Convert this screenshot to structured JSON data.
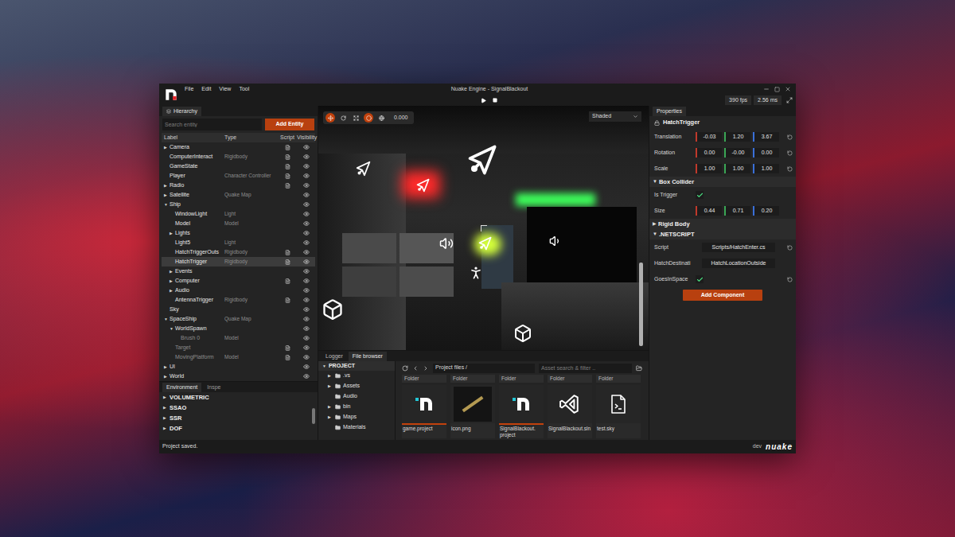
{
  "window": {
    "title": "Nuake Engine - SignalBlackout",
    "menu": [
      "File",
      "Edit",
      "View",
      "Tool"
    ],
    "fps": "390 fps",
    "frame_time": "2.56 ms"
  },
  "glyphs": {
    "expanded": "▼",
    "collapsed": "▶"
  },
  "hierarchy": {
    "tab": "Hierarchy",
    "search_placeholder": "Search entity",
    "add_button": "Add Entity",
    "columns": [
      "Label",
      "Type",
      "Script",
      "Visibility"
    ],
    "rows": [
      {
        "label": "Camera",
        "type": "",
        "script": true,
        "visible": true,
        "expandable": true,
        "expanded": false,
        "selected": false,
        "disabled": false
      },
      {
        "label": "ComputerInteract",
        "type": "Rigidbody",
        "script": true,
        "visible": true,
        "expandable": false,
        "expanded": false,
        "selected": false,
        "disabled": false
      },
      {
        "label": "GameState",
        "type": "",
        "script": true,
        "visible": true,
        "expandable": false,
        "expanded": false,
        "selected": false,
        "disabled": false
      },
      {
        "label": "Player",
        "type": "Character Controller",
        "script": true,
        "visible": true,
        "expandable": false,
        "expanded": false,
        "selected": false,
        "disabled": false
      },
      {
        "label": "Radio",
        "type": "",
        "script": true,
        "visible": true,
        "expandable": true,
        "expanded": false,
        "selected": false,
        "disabled": false
      },
      {
        "label": "Satellite",
        "type": "Quake Map",
        "script": false,
        "visible": true,
        "expandable": true,
        "expanded": false,
        "selected": false,
        "disabled": false
      },
      {
        "label": "Ship",
        "type": "",
        "script": false,
        "visible": true,
        "expandable": true,
        "expanded": true,
        "selected": false,
        "disabled": false,
        "children": [
          {
            "label": "WindowLight",
            "type": "Light",
            "script": false,
            "visible": true,
            "expandable": false,
            "expanded": false,
            "selected": false,
            "disabled": false
          },
          {
            "label": "Model",
            "type": "Model",
            "script": false,
            "visible": true,
            "expandable": false,
            "expanded": false,
            "selected": false,
            "disabled": false
          },
          {
            "label": "Lights",
            "type": "",
            "script": false,
            "visible": true,
            "expandable": true,
            "expanded": false,
            "selected": false,
            "disabled": false
          },
          {
            "label": "Light5",
            "type": "Light",
            "script": false,
            "visible": true,
            "expandable": false,
            "expanded": false,
            "selected": false,
            "disabled": false
          },
          {
            "label": "HatchTriggerOuts",
            "type": "Rigidbody",
            "script": true,
            "visible": true,
            "expandable": false,
            "expanded": false,
            "selected": false,
            "disabled": false
          },
          {
            "label": "HatchTrigger",
            "type": "Rigidbody",
            "script": true,
            "visible": true,
            "expandable": false,
            "expanded": false,
            "selected": true,
            "disabled": false
          },
          {
            "label": "Events",
            "type": "",
            "script": false,
            "visible": true,
            "expandable": true,
            "expanded": false,
            "selected": false,
            "disabled": false
          },
          {
            "label": "Computer",
            "type": "",
            "script": true,
            "visible": true,
            "expandable": true,
            "expanded": false,
            "selected": false,
            "disabled": false
          },
          {
            "label": "Audio",
            "type": "",
            "script": false,
            "visible": true,
            "expandable": true,
            "expanded": false,
            "selected": false,
            "disabled": false
          },
          {
            "label": "AntennaTrigger",
            "type": "Rigidbody",
            "script": true,
            "visible": true,
            "expandable": false,
            "expanded": false,
            "selected": false,
            "disabled": false
          }
        ]
      },
      {
        "label": "Sky",
        "type": "",
        "script": false,
        "visible": true,
        "expandable": false,
        "expanded": false,
        "selected": false,
        "disabled": false
      },
      {
        "label": "SpaceShip",
        "type": "Quake Map",
        "script": false,
        "visible": true,
        "expandable": true,
        "expanded": true,
        "selected": false,
        "disabled": false,
        "children": [
          {
            "label": "WorldSpawn",
            "type": "",
            "script": false,
            "visible": true,
            "expandable": true,
            "expanded": true,
            "selected": false,
            "disabled": false,
            "children": [
              {
                "label": "Brush 0",
                "type": "Model",
                "script": false,
                "visible": true,
                "expandable": false,
                "expanded": false,
                "selected": false,
                "disabled": true
              }
            ]
          },
          {
            "label": "Target",
            "type": "",
            "script": true,
            "visible": true,
            "expandable": false,
            "expanded": false,
            "selected": false,
            "disabled": true
          },
          {
            "label": "MovingPlatform",
            "type": "Model",
            "script": true,
            "visible": true,
            "expandable": false,
            "expanded": false,
            "selected": false,
            "disabled": true
          }
        ]
      },
      {
        "label": "UI",
        "type": "",
        "script": false,
        "visible": true,
        "expandable": true,
        "expanded": false,
        "selected": false,
        "disabled": false
      },
      {
        "label": "World",
        "type": "",
        "script": false,
        "visible": true,
        "expandable": true,
        "expanded": false,
        "selected": false,
        "disabled": false
      }
    ]
  },
  "environment": {
    "tabs": [
      {
        "label": "Environment",
        "selected": true
      },
      {
        "label": "Inspe",
        "selected": false
      }
    ],
    "sections": [
      {
        "label": "VOLUMETRIC",
        "expanded": false
      },
      {
        "label": "SSAO",
        "expanded": false
      },
      {
        "label": "SSR",
        "expanded": false
      },
      {
        "label": "DOF",
        "expanded": false
      }
    ]
  },
  "viewport": {
    "tools": [
      {
        "selected": true
      },
      {
        "selected": false
      },
      {
        "selected": false
      },
      {
        "selected": true
      },
      {
        "selected": false
      }
    ],
    "time": "0.000",
    "shading": "Shaded"
  },
  "bottom_panel": {
    "tabs": [
      {
        "label": "Logger",
        "selected": false
      },
      {
        "label": "File browser",
        "selected": true
      }
    ],
    "tree": {
      "root": "PROJECT",
      "expanded": true,
      "items": [
        {
          "label": ".vs",
          "expandable": true,
          "expanded": false
        },
        {
          "label": "Assets",
          "expandable": true,
          "expanded": false
        },
        {
          "label": "Audio",
          "expandable": false,
          "expanded": false
        },
        {
          "label": "bin",
          "expandable": true,
          "expanded": false
        },
        {
          "label": "Maps",
          "expandable": true,
          "expanded": false
        },
        {
          "label": "Materials",
          "expandable": false,
          "expanded": false
        }
      ]
    },
    "path": "Project files /",
    "search_placeholder": "Asset search & filter ..",
    "folders": [
      "Folder",
      "Folder",
      "Folder",
      "Folder",
      "Folder"
    ],
    "files": [
      {
        "label": "game.project",
        "kind": "project"
      },
      {
        "label": "icon.png",
        "kind": "image"
      },
      {
        "label": "SignalBlackout. project",
        "kind": "project"
      },
      {
        "label": "SignalBlackout.sln",
        "kind": "solution"
      },
      {
        "label": "test.sky",
        "kind": "script"
      }
    ]
  },
  "properties": {
    "tab": "Properties",
    "entity": "HatchTrigger",
    "transform": [
      {
        "label": "Translation",
        "values": [
          "-0.03",
          "1.20",
          "3.67"
        ]
      },
      {
        "label": "Rotation",
        "values": [
          "0.00",
          "-0.00",
          "0.00"
        ]
      },
      {
        "label": "Scale",
        "values": [
          "1.00",
          "1.00",
          "1.00"
        ]
      }
    ],
    "components": [
      {
        "title": "Box Collider",
        "expanded": true,
        "fields": [
          {
            "kind": "checkbox",
            "label": "Is Trigger",
            "checked": true,
            "reset": false
          },
          {
            "kind": "vector",
            "label": "Size",
            "values": [
              "0.44",
              "0.71",
              "0.20"
            ],
            "reset": false
          }
        ]
      },
      {
        "title": "Rigid Body",
        "expanded": false,
        "fields": []
      },
      {
        "title": ".NETSCRIPT",
        "expanded": true,
        "fields": [
          {
            "kind": "text",
            "label": "Script",
            "value": "Scripts/HatchEnter.cs",
            "reset": true
          },
          {
            "kind": "text",
            "label": "HatchDestinati",
            "value": "HatchLocationOutside",
            "reset": false
          },
          {
            "kind": "checkbox",
            "label": "GoesInSpace",
            "checked": true,
            "reset": true
          }
        ]
      }
    ],
    "add_button": "Add Component"
  },
  "status_bar": {
    "message": "Project saved.",
    "branch": "dev",
    "logo": "nuake"
  }
}
